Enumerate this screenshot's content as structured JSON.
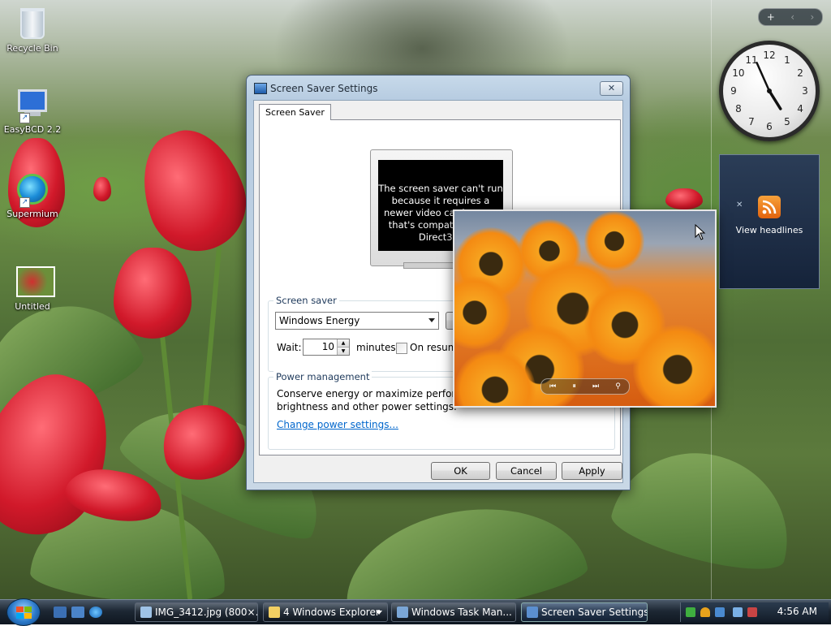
{
  "desktop": {
    "icons": [
      {
        "label": "Recycle Bin",
        "icon": "recycle-bin-icon"
      },
      {
        "label": "EasyBCD 2.2",
        "icon": "easybcd-icon"
      },
      {
        "label": "Supermium",
        "icon": "supermium-icon"
      },
      {
        "label": "Untitled",
        "icon": "image-file-icon"
      }
    ]
  },
  "gadgets": {
    "controls": {
      "add": "+",
      "prev": "‹",
      "next": "›"
    },
    "clock": {
      "hours": 4,
      "minutes": 56,
      "numerals": [
        "12",
        "1",
        "2",
        "3",
        "4",
        "5",
        "6",
        "7",
        "8",
        "9",
        "10",
        "11"
      ]
    },
    "feeds": {
      "label": "View headlines",
      "icon": "rss-icon"
    }
  },
  "dialog": {
    "title": "Screen Saver Settings",
    "close": "✕",
    "tab": "Screen Saver",
    "preview_message": "The screen saver can't run because it requires a newer video card or one that's compatible with Direct3D.",
    "screen_saver_group": "Screen saver",
    "screen_saver_value": "Windows Energy",
    "wait_label": "Wait:",
    "wait_value": "10",
    "minutes_label": "minutes",
    "resume_label": "On resume, display logon screen",
    "power_group": "Power management",
    "power_text_1": "Conserve energy or maximize performance by adjusting display",
    "power_text_2": "brightness and other power settings.",
    "power_link": "Change power settings...",
    "ok": "OK",
    "cancel": "Cancel",
    "apply": "Apply"
  },
  "taskbar": {
    "tasks": [
      {
        "label": "IMG_3412.jpg (800×...",
        "icon": "photo-viewer-icon",
        "active": false
      },
      {
        "label": "4 Windows Explorer",
        "icon": "folder-icon",
        "active": false
      },
      {
        "label": "Windows Task Man...",
        "icon": "task-manager-icon",
        "active": false
      },
      {
        "label": "Screen Saver Settings",
        "icon": "display-settings-icon",
        "active": true
      }
    ],
    "time": "4:56 AM"
  },
  "colors": {
    "accent": "#1d5aa8",
    "link": "#0066cc"
  }
}
